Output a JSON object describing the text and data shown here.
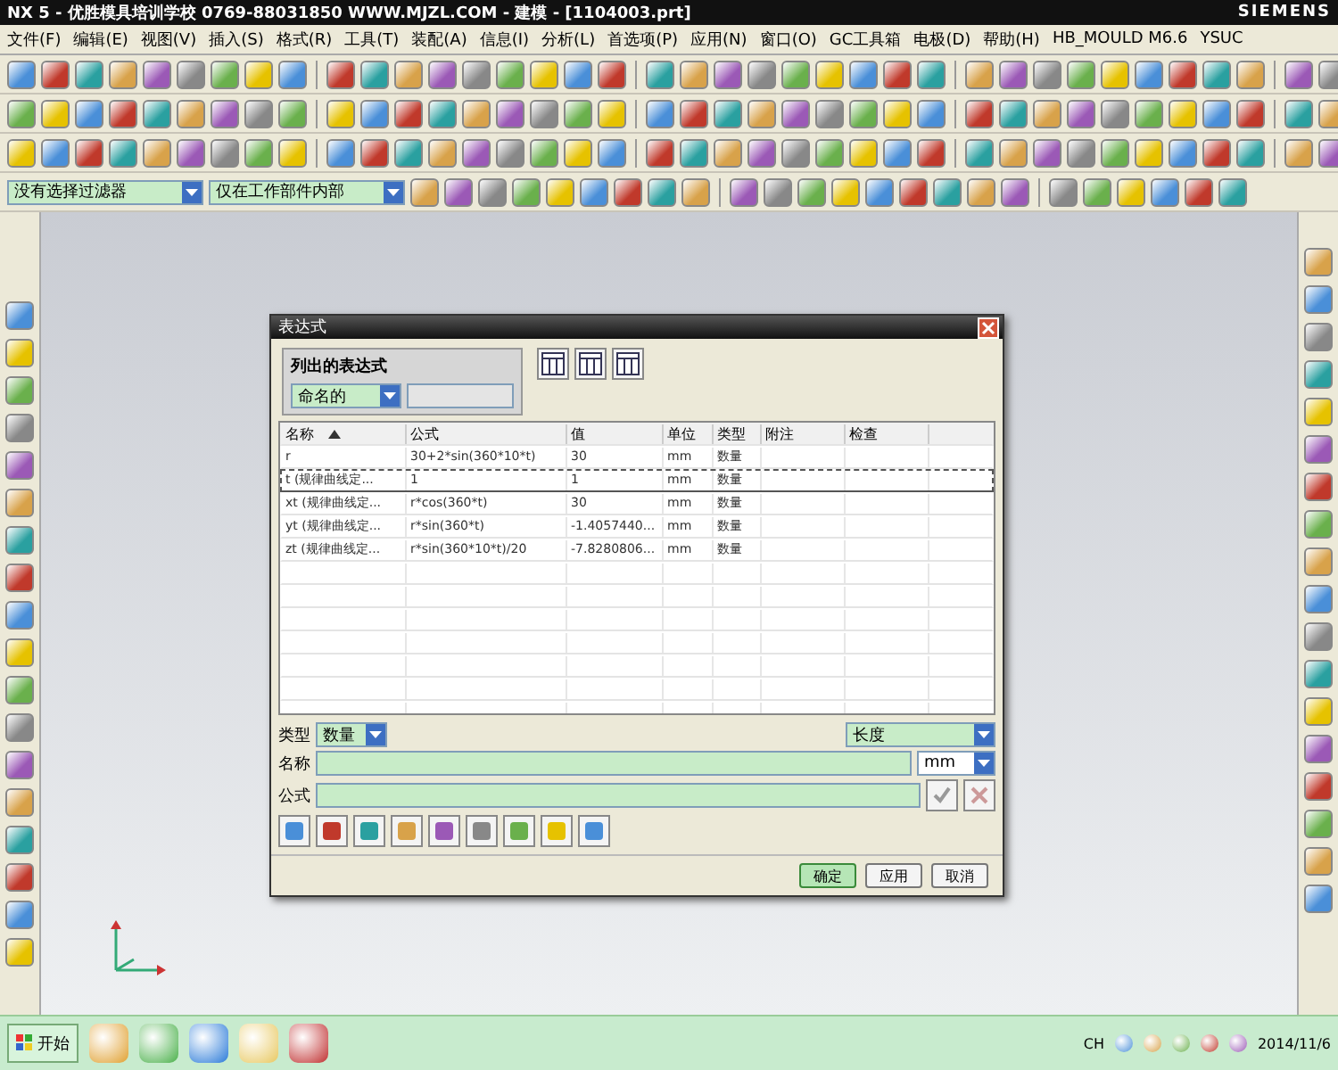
{
  "window": {
    "title": "NX 5 - 优胜模具培训学校 0769-88031850 WWW.MJZL.COM - 建模 - [1104003.prt]",
    "brand": "SIEMENS"
  },
  "menu": [
    "文件(F)",
    "编辑(E)",
    "视图(V)",
    "插入(S)",
    "格式(R)",
    "工具(T)",
    "装配(A)",
    "信息(I)",
    "分析(L)",
    "首选项(P)",
    "应用(N)",
    "窗口(O)",
    "GC工具箱",
    "电极(D)",
    "帮助(H)",
    "HB_MOULD M6.6",
    "YSUC"
  ],
  "filter_bar": {
    "selection_filter": "没有选择过滤器",
    "scope": "仅在工作部件内部"
  },
  "dialog": {
    "title": "表达式",
    "listed_group": {
      "label": "列出的表达式",
      "filter": "命名的"
    },
    "columns": [
      "名称",
      "公式",
      "值",
      "单位",
      "类型",
      "附注",
      "检查"
    ],
    "rows": [
      {
        "name": "r",
        "formula": "30+2*sin(360*10*t)",
        "value": "30",
        "unit": "mm",
        "type": "数量",
        "selected": false
      },
      {
        "name": "t (规律曲线定...",
        "formula": "1",
        "value": "1",
        "unit": "mm",
        "type": "数量",
        "selected": true
      },
      {
        "name": "xt (规律曲线定...",
        "formula": "r*cos(360*t)",
        "value": "30",
        "unit": "mm",
        "type": "数量",
        "selected": false
      },
      {
        "name": "yt (规律曲线定...",
        "formula": "r*sin(360*t)",
        "value": "-1.4057440...",
        "unit": "mm",
        "type": "数量",
        "selected": false
      },
      {
        "name": "zt (规律曲线定...",
        "formula": "r*sin(360*10*t)/20",
        "value": "-7.8280806...",
        "unit": "mm",
        "type": "数量",
        "selected": false
      }
    ],
    "type_label": "类型",
    "type_value": "数量",
    "dimension_value": "长度",
    "name_label": "名称",
    "unit_value": "mm",
    "formula_label": "公式",
    "buttons": [
      "确定",
      "应用",
      "取消"
    ]
  },
  "taskbar": {
    "start": "开始",
    "language": "CH",
    "date": "2014/11/6"
  }
}
